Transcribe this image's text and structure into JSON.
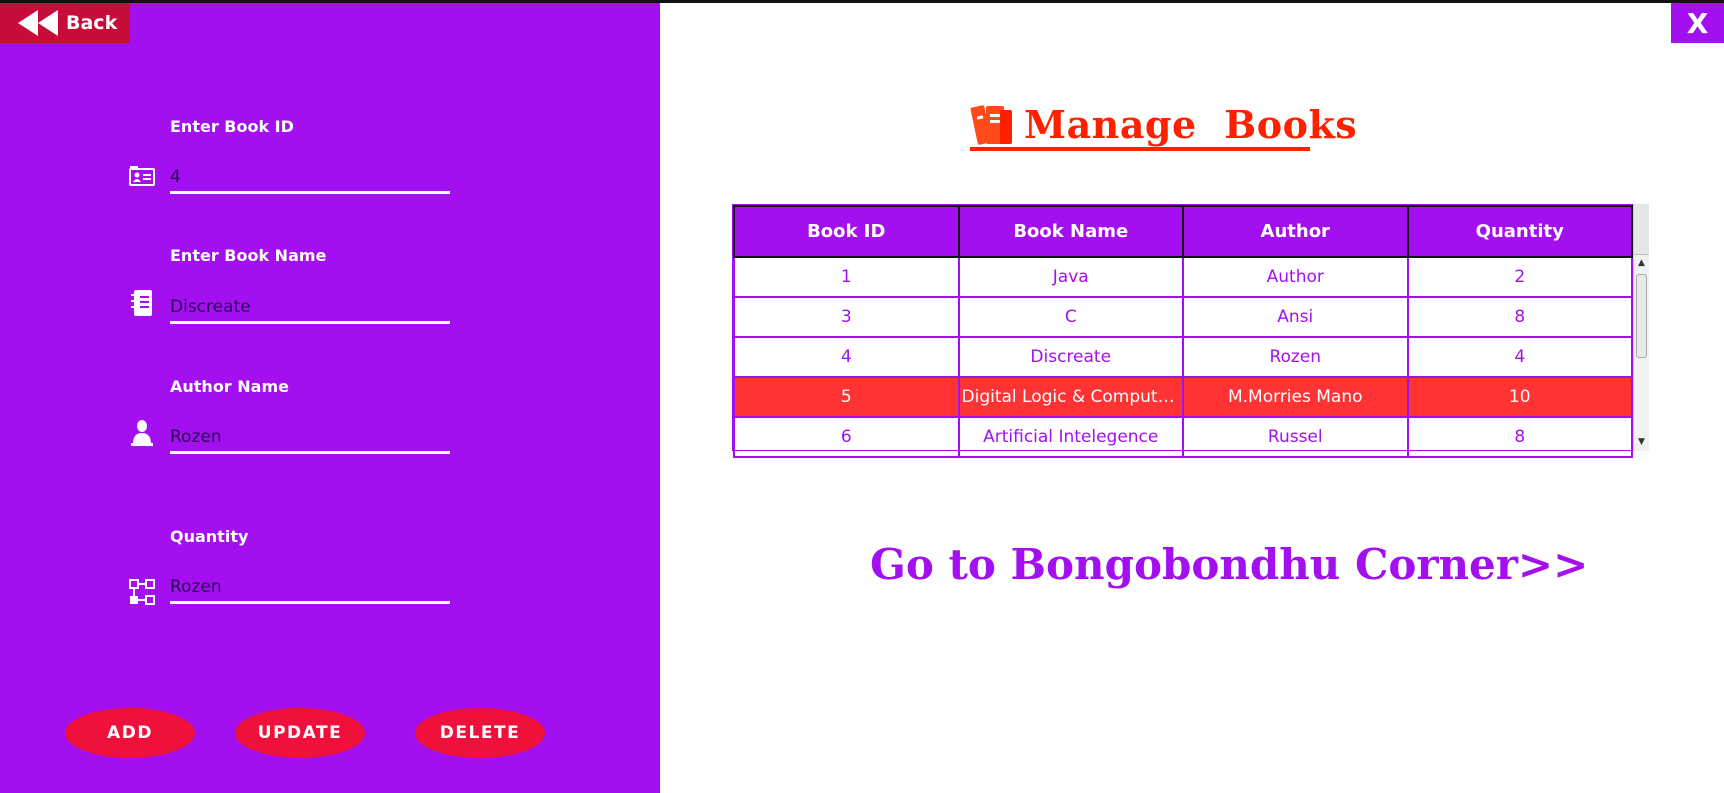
{
  "window": {
    "close_label": "X"
  },
  "back_button": {
    "label": "Back"
  },
  "form": {
    "book_id": {
      "label": "Enter Book ID",
      "value": "4",
      "icon": "id-card-icon"
    },
    "book_name": {
      "label": "Enter Book Name",
      "value": "Discreate",
      "icon": "notebook-icon"
    },
    "author_name": {
      "label": "Author Name",
      "value": "Rozen",
      "icon": "person-icon"
    },
    "quantity": {
      "label": "Quantity",
      "value": "Rozen",
      "icon": "hierarchy-icon"
    }
  },
  "actions": {
    "add": "ADD",
    "update": "UPDATE",
    "delete": "DELETE"
  },
  "header": {
    "title": "Manage  Books ",
    "icon": "books-icon"
  },
  "table": {
    "columns": [
      "Book ID",
      "Book Name",
      "Author",
      "Quantity"
    ],
    "rows": [
      {
        "id": "1",
        "name": "Java",
        "author": "Author",
        "quantity": "2"
      },
      {
        "id": "3",
        "name": "C",
        "author": "Ansi",
        "quantity": "8"
      },
      {
        "id": "4",
        "name": "Discreate",
        "author": "Rozen",
        "quantity": "4"
      },
      {
        "id": "5",
        "name": "Digital Logic & Computer...",
        "author": "M.Morries Mano",
        "quantity": "10"
      },
      {
        "id": "6",
        "name": "Artificial Intelegence",
        "author": "Russel",
        "quantity": "8"
      }
    ],
    "selected_row": 3
  },
  "corner_link": {
    "label": "Go to Bongobondhu Corner>>"
  },
  "colors": {
    "panel": "#a40ff0",
    "accent": "#f0103c",
    "title": "#ff2000",
    "selected_row": "#ff3333"
  }
}
